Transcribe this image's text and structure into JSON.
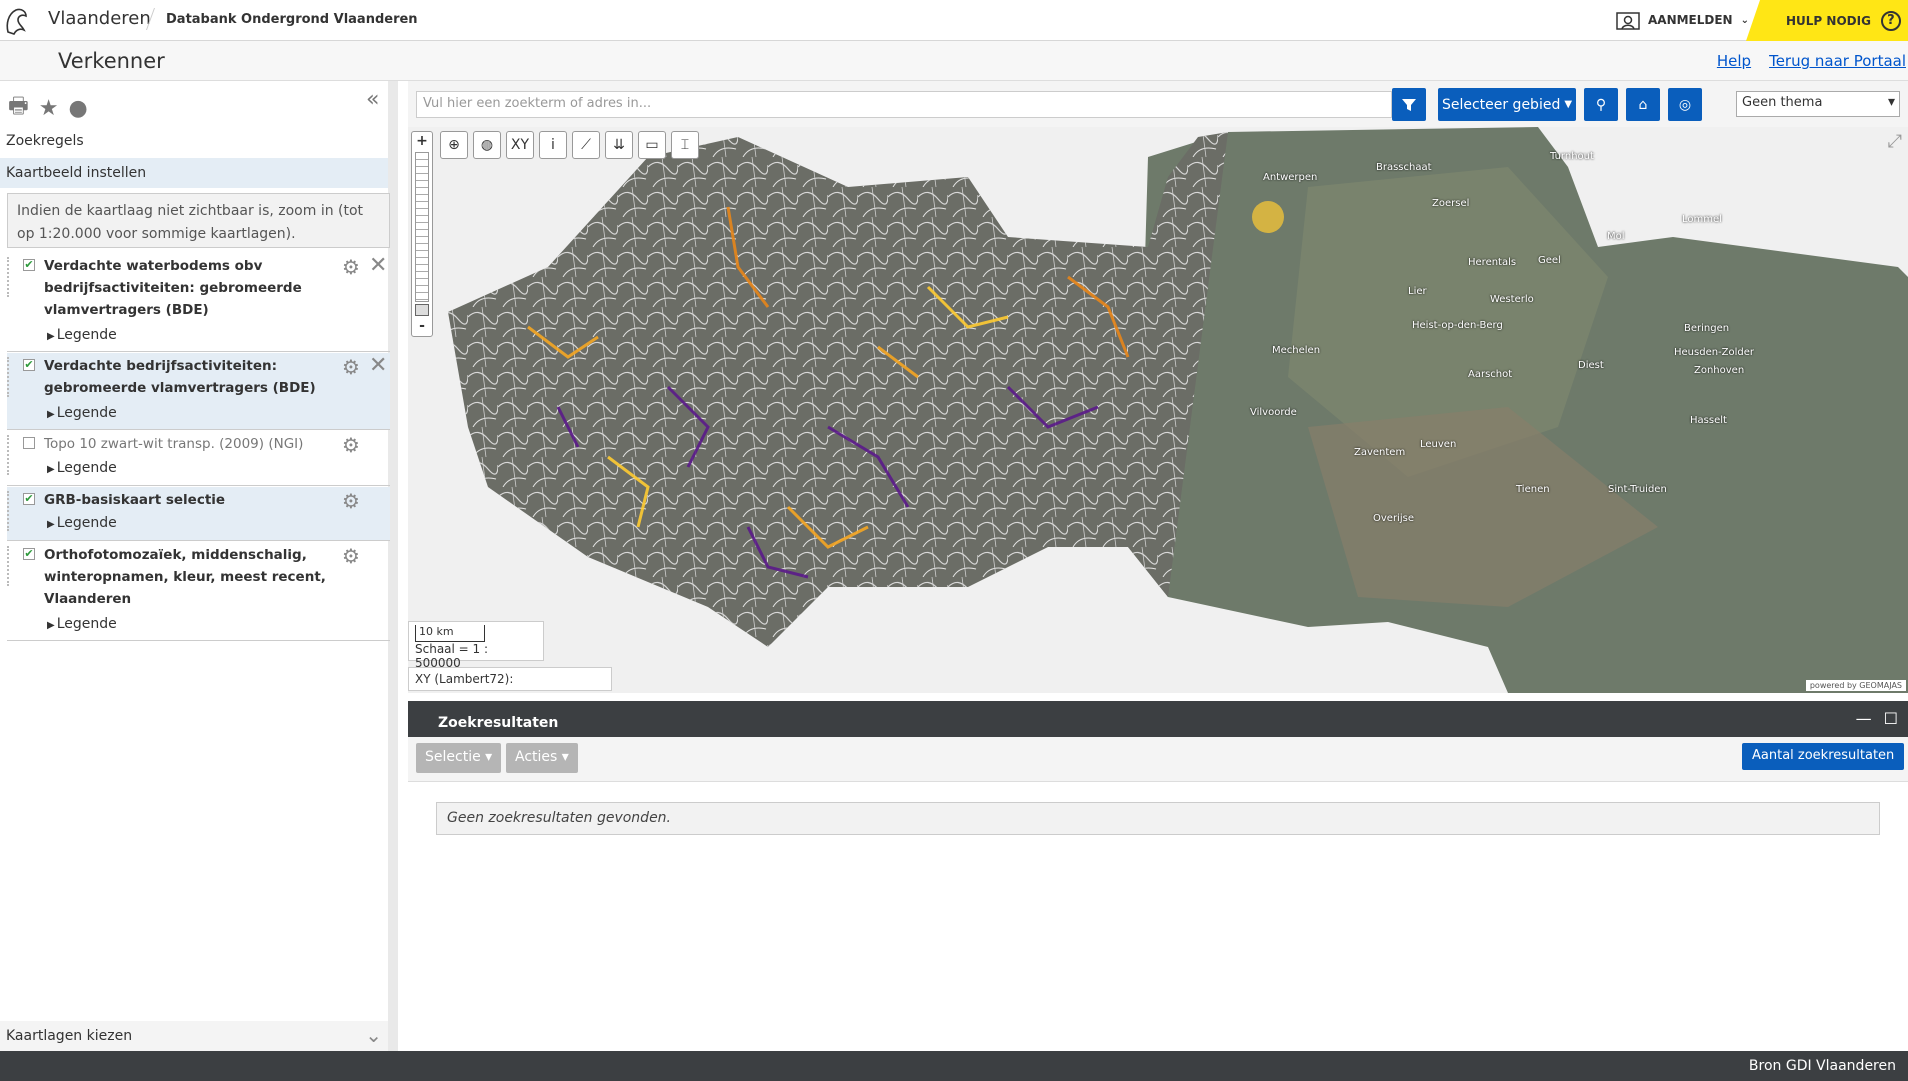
{
  "header": {
    "brand": "Vlaanderen",
    "subtitle": "Databank Ondergrond Vlaanderen",
    "login_label": "AANMELDEN",
    "help_label": "HULP NODIG",
    "help_icon": "?"
  },
  "titlebar": {
    "title": "Verkenner",
    "links": [
      "Help",
      "Terug naar Portaal"
    ]
  },
  "sidebar": {
    "section_search": "Zoekregels",
    "section_map": "Kaartbeeld instellen",
    "note": "Indien de kaartlaag niet zichtbaar is, zoom in (tot op 1:20.000 voor sommige kaartlagen).",
    "layers": [
      {
        "name": "Verdachte waterbodems obv bedrijfsactiviteiten: gebromeerde vlamvertragers (BDE)",
        "checked": true,
        "legend": "Legende"
      },
      {
        "name": "Verdachte bedrijfsactiviteiten: gebromeerde vlamvertragers (BDE)",
        "checked": true,
        "legend": "Legende"
      },
      {
        "name": "Topo 10 zwart-wit transp. (2009) (NGI)",
        "checked": false,
        "legend": "Legende"
      },
      {
        "name": "GRB-basiskaart selectie",
        "checked": true,
        "legend": "Legende"
      },
      {
        "name": "Orthofotomozaïek, middenschalig, winteropnamen, kleur, meest recent, Vlaanderen",
        "checked": true,
        "legend": "Legende"
      }
    ],
    "footer": "Kaartlagen kiezen"
  },
  "searchbar": {
    "placeholder": "Vul hier een zoekterm of adres in...",
    "select_area": "Selecteer gebied",
    "theme": "Geen thema"
  },
  "map": {
    "tools": [
      "zoom-in-icon",
      "globe-icon",
      "XY",
      "i",
      "ruler-icon",
      "drill-icon",
      "folder-icon",
      "chart-icon"
    ],
    "scale_bar": "10 km",
    "scale": "Schaal = 1 : 500000",
    "coords": "XY (Lambert72):",
    "powered": "powered by GEOMAJAS",
    "places": [
      "Antwerpen",
      "Brasschaat",
      "Zoersel",
      "Turnhout",
      "Mechelen",
      "Herentals",
      "Geel",
      "Mol",
      "Lommel",
      "Lier",
      "Westerlo",
      "Heist-op-den-Berg",
      "Beringen",
      "Aarschot",
      "Diest",
      "Heusden-Zolder",
      "Vilvoorde",
      "Leuven",
      "Hasselt",
      "Zaventem",
      "Tienen",
      "Sint-Truiden",
      "Overijse",
      "Zonhoven"
    ]
  },
  "results": {
    "title": "Zoekresultaten",
    "selectie": "Selectie",
    "acties": "Acties",
    "count_button": "Aantal zoekresultaten",
    "empty": "Geen zoekresultaten gevonden."
  },
  "footer": {
    "text": "Bron GDI Vlaanderen"
  }
}
